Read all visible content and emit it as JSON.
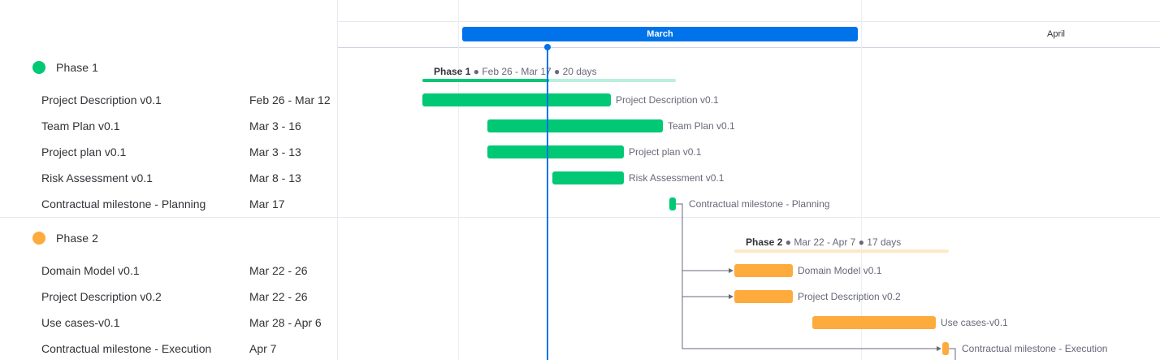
{
  "timeline": {
    "months": [
      {
        "label": "March",
        "active": true,
        "color": "#0073ea"
      },
      {
        "label": "April",
        "active": false
      }
    ]
  },
  "groups": [
    {
      "title": "Phase 1",
      "color": "#00c875",
      "summary": {
        "name": "Phase 1",
        "range": "Feb 26 - Mar 17",
        "duration": "20 days"
      },
      "progress": 0.5,
      "tasks": [
        {
          "name": "Project Description v0.1",
          "dates": "Feb 26 - Mar 12",
          "type": "task"
        },
        {
          "name": "Team Plan v0.1",
          "dates": "Mar 3 - 16",
          "type": "task"
        },
        {
          "name": "Project plan v0.1",
          "dates": "Mar 3 - 13",
          "type": "task"
        },
        {
          "name": "Risk Assessment v0.1",
          "dates": "Mar 8 - 13",
          "type": "task"
        },
        {
          "name": "Contractual milestone - Planning",
          "dates": "Mar 17",
          "type": "milestone"
        }
      ]
    },
    {
      "title": "Phase 2",
      "color": "#fdab3d",
      "summary": {
        "name": "Phase 2",
        "range": "Mar 22 - Apr 7",
        "duration": "17 days"
      },
      "progress": 0,
      "tasks": [
        {
          "name": "Domain Model v0.1",
          "dates": "Mar 22 - 26",
          "type": "task"
        },
        {
          "name": "Project Description v0.2",
          "dates": "Mar 22 - 26",
          "type": "task"
        },
        {
          "name": "Use cases-v0.1",
          "dates": "Mar 28 - Apr 6",
          "type": "task"
        },
        {
          "name": "Contractual milestone - Execution",
          "dates": "Apr 7",
          "type": "milestone"
        }
      ]
    }
  ],
  "colors": {
    "today": "#0073ea",
    "phase1_track": "#bbeedd",
    "phase2_track": "#fde8c8",
    "dependency": "#676879"
  }
}
